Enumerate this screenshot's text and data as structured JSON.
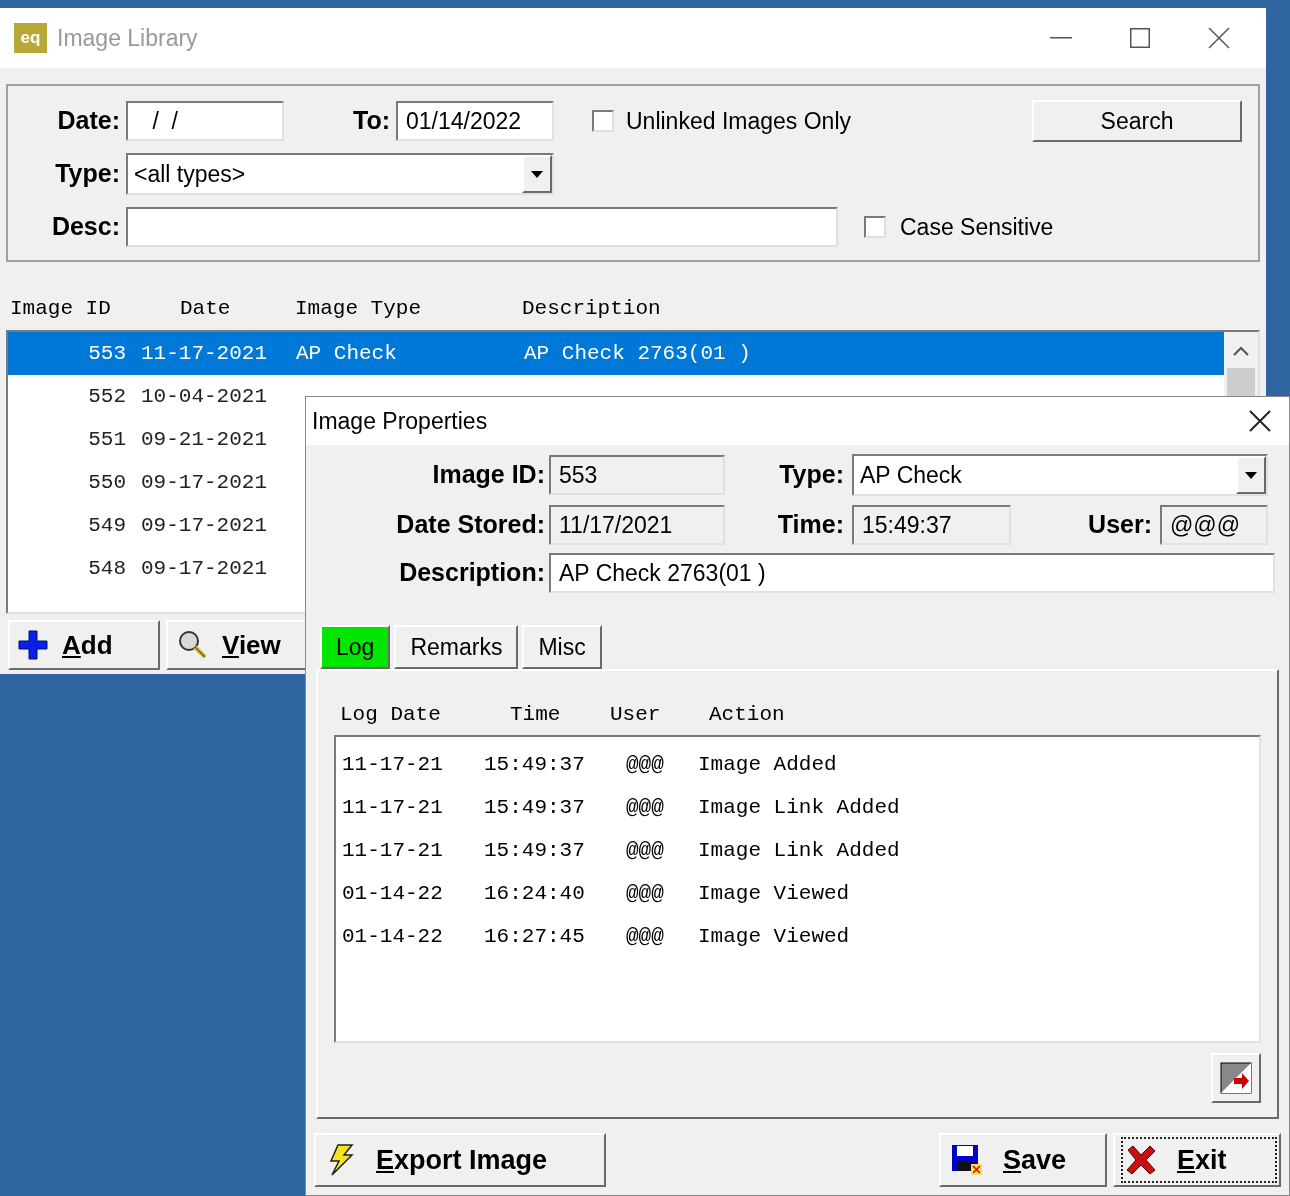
{
  "library": {
    "title": "Image Library",
    "app_icon": "eq",
    "filters": {
      "date_label": "Date:",
      "date_value": " /  /",
      "to_label": "To:",
      "to_value": "01/14/2022",
      "unlinked": {
        "label": "Unlinked Images Only",
        "checked": false
      },
      "search_button": "Search",
      "type_label": "Type:",
      "type_value": "<all types>",
      "desc_label": "Desc:",
      "case_sensitive": {
        "label": "Case Sensitive",
        "checked": false
      }
    },
    "columns": [
      "Image ID",
      "Date",
      "Image Type",
      "Description"
    ],
    "rows": [
      {
        "id": "553",
        "date": "11-17-2021",
        "type": "AP Check",
        "description": "AP Check 2763(01 )",
        "selected": true
      },
      {
        "id": "552",
        "date": "10-04-2021",
        "selected": false
      },
      {
        "id": "551",
        "date": "09-21-2021",
        "selected": false
      },
      {
        "id": "550",
        "date": "09-17-2021",
        "selected": false
      },
      {
        "id": "549",
        "date": "09-17-2021",
        "selected": false
      },
      {
        "id": "548",
        "date": "09-17-2021",
        "selected": false
      }
    ],
    "buttons": [
      "Add",
      "View"
    ]
  },
  "dialog": {
    "title": "Image Properties",
    "image_id_label": "Image ID:",
    "image_id": "553",
    "type_label": "Type:",
    "type": "AP Check",
    "date_stored_label": "Date Stored:",
    "date_stored": "11/17/2021",
    "time_label": "Time:",
    "time": "15:49:37",
    "user_label": "User:",
    "user": "@@@",
    "description_label": "Description:",
    "description": "AP Check 2763(01 )",
    "tabs": [
      {
        "label": "Log",
        "selected": true
      },
      {
        "label": "Remarks",
        "selected": false
      },
      {
        "label": "Misc",
        "selected": false
      }
    ],
    "log_columns": [
      "Log Date",
      "Time",
      "User",
      "Action"
    ],
    "log_rows": [
      {
        "date": "11-17-21",
        "time": "15:49:37",
        "user": "@@@",
        "action": "Image Added"
      },
      {
        "date": "11-17-21",
        "time": "15:49:37",
        "user": "@@@",
        "action": "Image Link Added"
      },
      {
        "date": "11-17-21",
        "time": "15:49:37",
        "user": "@@@",
        "action": "Image Link Added"
      },
      {
        "date": "01-14-22",
        "time": "16:24:40",
        "user": "@@@",
        "action": "Image Viewed"
      },
      {
        "date": "01-14-22",
        "time": "16:27:45",
        "user": "@@@",
        "action": "Image Viewed"
      }
    ],
    "buttons": [
      {
        "label": "Export Image",
        "focused": false
      },
      {
        "label": "Save",
        "focused": false
      },
      {
        "label": "Exit",
        "focused": true
      }
    ]
  }
}
